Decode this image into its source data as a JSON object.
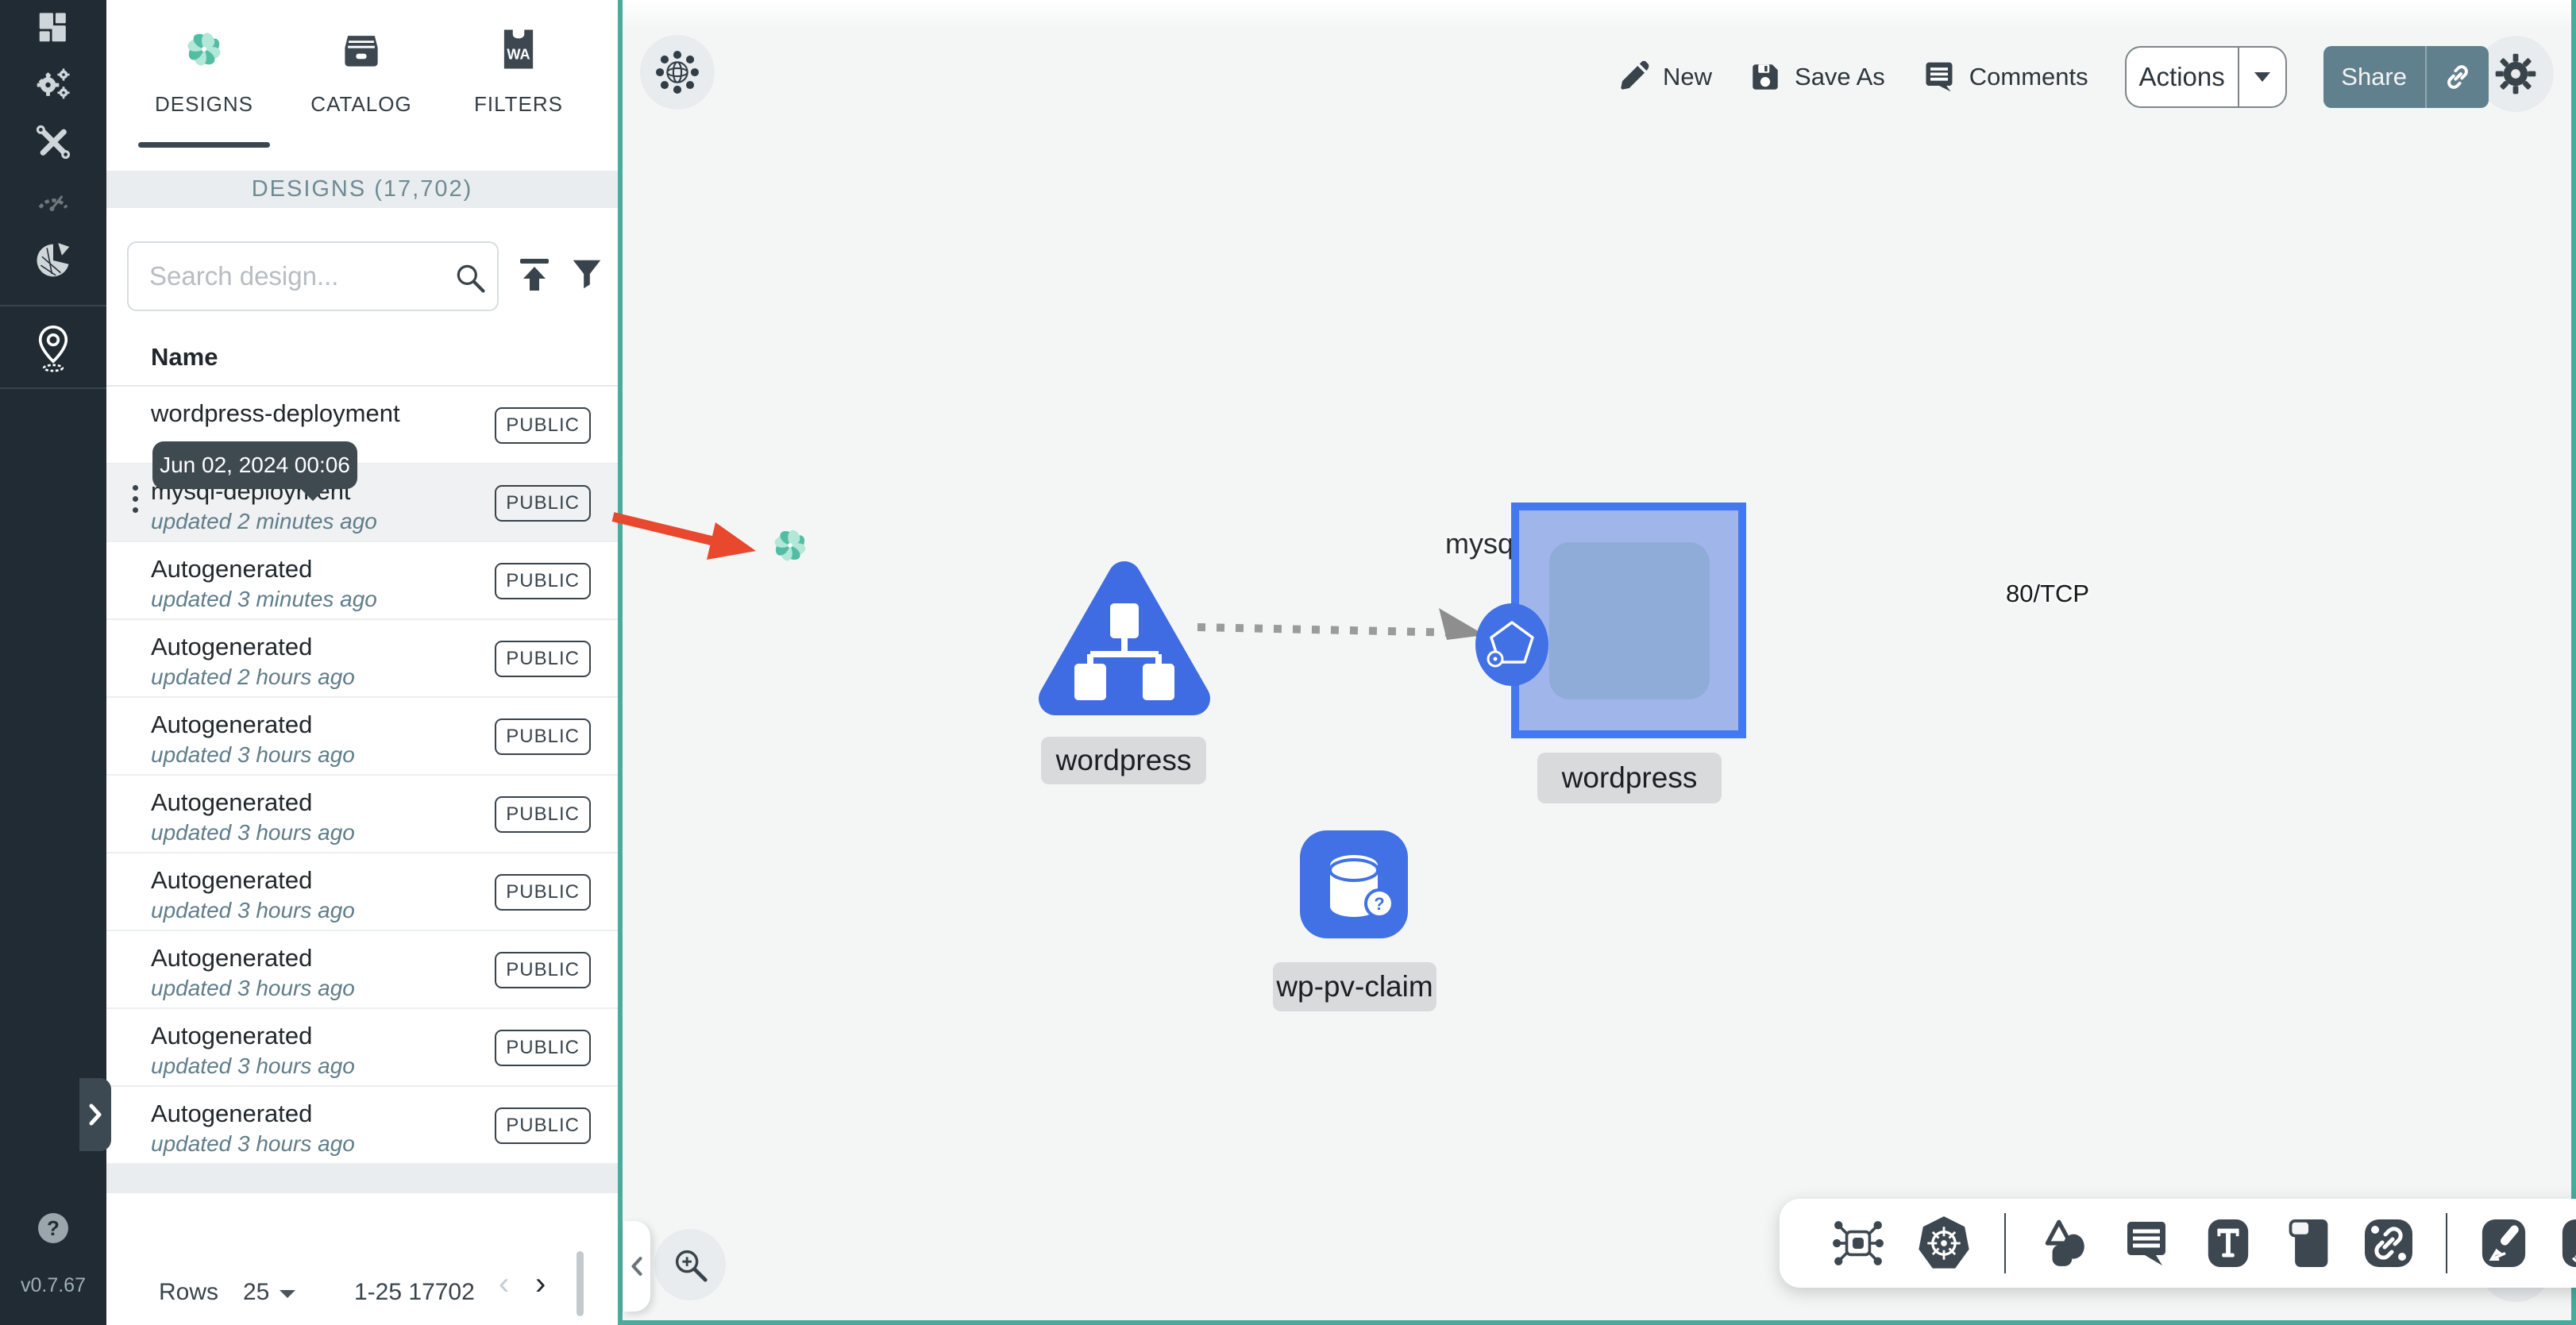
{
  "app": {
    "version": "v0.7.67",
    "help_label": "?"
  },
  "sidebar": {
    "items": [
      {
        "name": "dashboard"
      },
      {
        "name": "lifecycle"
      },
      {
        "name": "configuration"
      },
      {
        "name": "performance"
      },
      {
        "name": "extensions"
      },
      {
        "name": "kanvas"
      }
    ]
  },
  "drawer": {
    "tabs": [
      {
        "label": "DESIGNS",
        "active": true
      },
      {
        "label": "CATALOG",
        "active": false
      },
      {
        "label": "FILTERS",
        "active": false,
        "icon_text": "WA"
      }
    ],
    "panel_header": "DESIGNS (17,702)",
    "search_placeholder": "Search design...",
    "column_header": "Name",
    "tooltip": "Jun 02, 2024 00:06",
    "rows": [
      {
        "name": "wordpress-deployment",
        "updated": "",
        "badge": "PUBLIC",
        "selected": false
      },
      {
        "name": "mysql-deployment",
        "updated": "updated 2 minutes ago",
        "badge": "PUBLIC",
        "selected": true
      },
      {
        "name": "Autogenerated",
        "updated": "updated 3 minutes ago",
        "badge": "PUBLIC",
        "selected": false
      },
      {
        "name": "Autogenerated",
        "updated": "updated 2 hours ago",
        "badge": "PUBLIC",
        "selected": false
      },
      {
        "name": "Autogenerated",
        "updated": "updated 3 hours ago",
        "badge": "PUBLIC",
        "selected": false
      },
      {
        "name": "Autogenerated",
        "updated": "updated 3 hours ago",
        "badge": "PUBLIC",
        "selected": false
      },
      {
        "name": "Autogenerated",
        "updated": "updated 3 hours ago",
        "badge": "PUBLIC",
        "selected": false
      },
      {
        "name": "Autogenerated",
        "updated": "updated 3 hours ago",
        "badge": "PUBLIC",
        "selected": false
      },
      {
        "name": "Autogenerated",
        "updated": "updated 3 hours ago",
        "badge": "PUBLIC",
        "selected": false
      },
      {
        "name": "Autogenerated",
        "updated": "updated 3 hours ago",
        "badge": "PUBLIC",
        "selected": false
      }
    ],
    "pagination": {
      "rows_label": "Rows",
      "page_size": "25",
      "range": "1-25 17702"
    }
  },
  "canvas": {
    "toolbar": {
      "new": "New",
      "save_as": "Save As",
      "comments": "Comments",
      "actions": "Actions",
      "share": "Share"
    },
    "edge_label": "80/TCP",
    "nodes": {
      "mysql": "mysql-deployment",
      "wordpress_service": "wordpress",
      "wordpress_deployment": "wordpress",
      "pv_claim": "wp-pv-claim"
    },
    "dock_tools": [
      "component",
      "kubernetes",
      "shapes",
      "comment",
      "text",
      "rectangle",
      "link",
      "arrow-pen",
      "pencil"
    ]
  },
  "colors": {
    "teal_border": "#49ab9c",
    "node_blue": "#4171e5",
    "square_border": "#4278f1",
    "share_button": "#61808d",
    "annotation_red": "#e8492e",
    "sidebar_bg": "#212b33"
  }
}
